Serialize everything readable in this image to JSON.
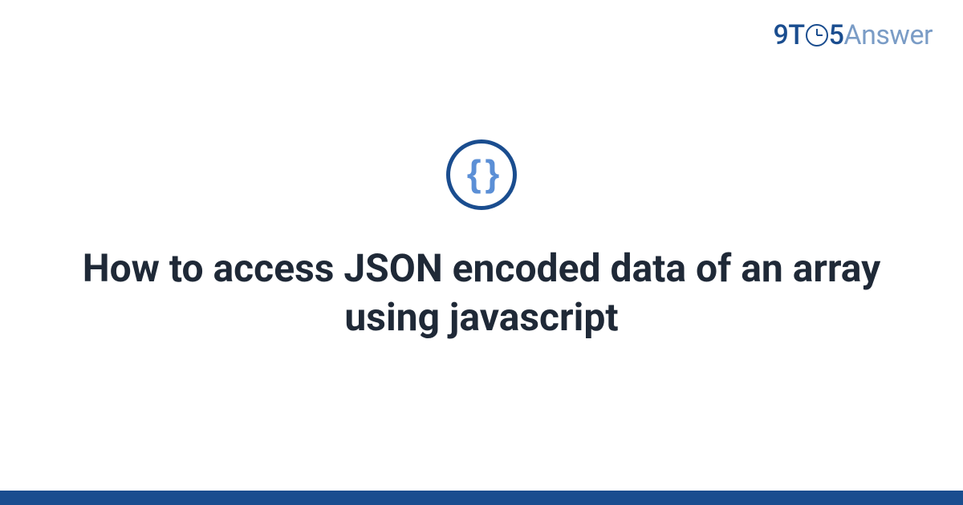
{
  "logo": {
    "part1": "9T",
    "part2": "5",
    "part3": "Answer"
  },
  "icon": {
    "braces": "{ }"
  },
  "title": "How to access JSON encoded data of an array using javascript"
}
